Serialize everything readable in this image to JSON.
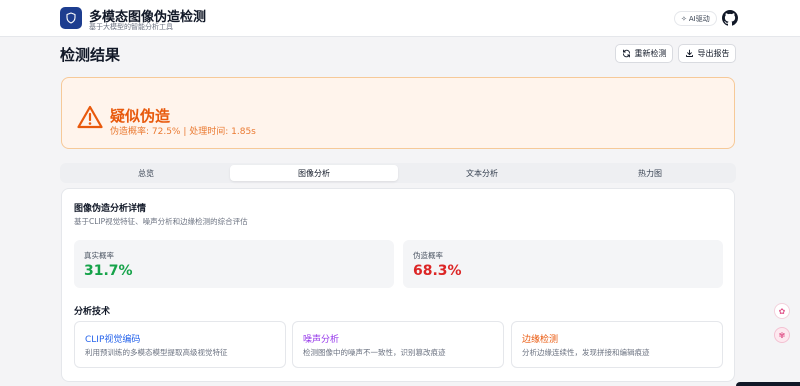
{
  "app": {
    "title": "多模态图像伪造检测",
    "subtitle": "基于大模型的智能分析工具",
    "ai_badge": "AI驱动",
    "logo_icon": "shield-icon",
    "github_icon": "github-icon"
  },
  "page": {
    "title": "检测结果",
    "redetect_label": "重新检测",
    "export_label": "导出报告"
  },
  "alert": {
    "title": "疑似伪造",
    "detail": "伪造概率: 72.5% | 处理时间: 1.85s",
    "icon": "warning-icon",
    "color": "#e8590c",
    "background": "#fff4ec"
  },
  "tabs": [
    {
      "label": "总览",
      "active": false
    },
    {
      "label": "图像分析",
      "active": true
    },
    {
      "label": "文本分析",
      "active": false
    },
    {
      "label": "热力图",
      "active": false
    }
  ],
  "analysis": {
    "title": "图像伪造分析详情",
    "description": "基于CLIP视觉特征、噪声分析和边缘检测的综合评估",
    "real_label": "真实概率",
    "real_value": "31.7%",
    "fake_label": "伪造概率",
    "fake_value": "68.3%",
    "real_color": "#16a34a",
    "fake_color": "#dc2626"
  },
  "techniques": {
    "heading": "分析技术",
    "items": [
      {
        "name": "CLIP视觉编码",
        "desc": "利用预训练的多模态模型提取高级视觉特征",
        "color": "#2563eb"
      },
      {
        "name": "噪声分析",
        "desc": "检测图像中的噪声不一致性，识别篡改痕迹",
        "color": "#9333ea"
      },
      {
        "name": "边缘检测",
        "desc": "分析边缘连续性，发现拼接和编辑痕迹",
        "color": "#ea580c"
      }
    ]
  }
}
